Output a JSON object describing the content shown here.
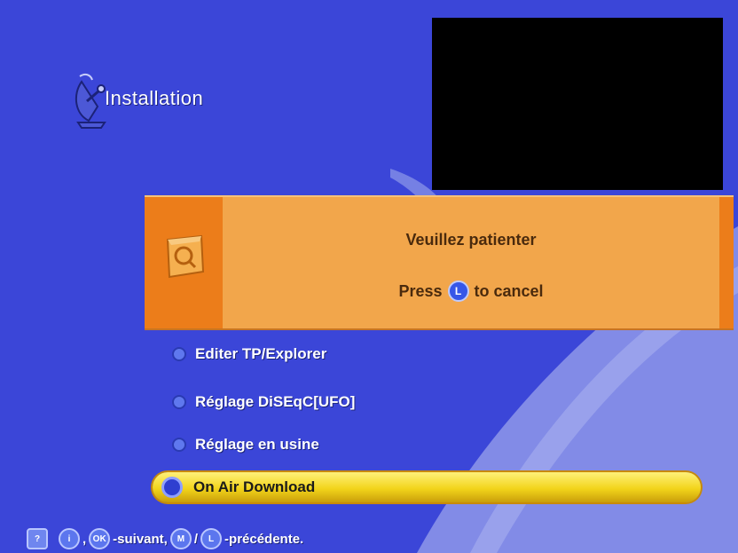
{
  "screen": {
    "title": "Installation",
    "title_icon": "satellite-dish-icon"
  },
  "dialog": {
    "icon": "magnifier-icon",
    "message": "Veuillez patienter",
    "cancel_prefix": "Press",
    "cancel_key": "L",
    "cancel_suffix": "to cancel"
  },
  "menu": {
    "items": [
      {
        "label": "Editer TP/Explorer",
        "selected": false
      },
      {
        "label": "Réglage DiSEqC[UFO]",
        "selected": false
      },
      {
        "label": "Réglage en usine",
        "selected": false
      },
      {
        "label": "On Air Download",
        "selected": true
      }
    ]
  },
  "footer": {
    "help_key": "?",
    "info_key": "i",
    "sep1": ",",
    "ok_key": "OK",
    "next_text": "-suivant,",
    "menu_key": "M",
    "slash": "/",
    "back_key": "L",
    "prev_text": "-précédente."
  },
  "colors": {
    "background": "#3b46d8",
    "dialog": "#f2a64b",
    "dialog_accent": "#ec7d1a",
    "selected_item": "#f2d41a"
  }
}
